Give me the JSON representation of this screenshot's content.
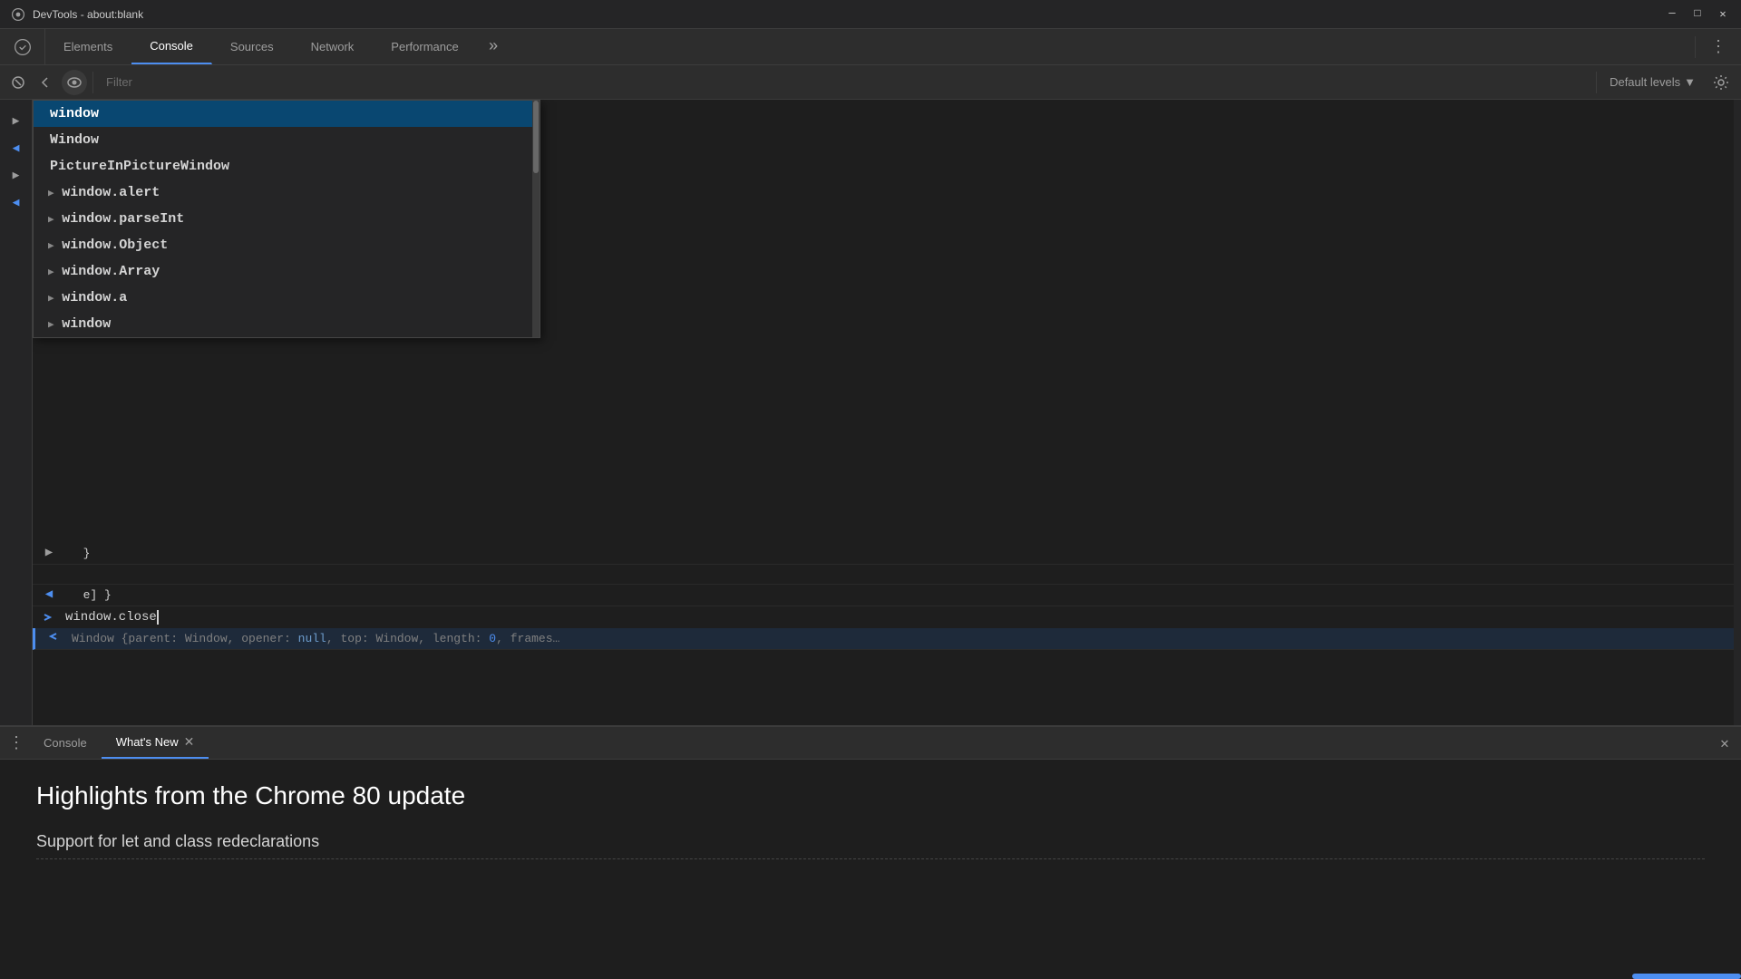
{
  "titleBar": {
    "icon": "🔧",
    "title": "DevTools - about:blank",
    "minimize": "─",
    "maximize": "□",
    "close": "✕"
  },
  "header": {
    "tabs": [
      {
        "label": "Elements",
        "active": false
      },
      {
        "label": "Console",
        "active": true
      },
      {
        "label": "Sources",
        "active": false
      },
      {
        "label": "Network",
        "active": false
      },
      {
        "label": "Performance",
        "active": false
      }
    ],
    "moreIcon": "»",
    "menuIcon": "⋮"
  },
  "toolbar": {
    "filterPlaceholder": "Filter",
    "defaultLevels": "Default levels",
    "dropdownIcon": "▼"
  },
  "autocomplete": {
    "items": [
      {
        "text": "window",
        "arrow": "",
        "selected": true
      },
      {
        "text": "Window",
        "arrow": "",
        "selected": false
      },
      {
        "text": "PictureInPictureWindow",
        "arrow": "",
        "selected": false
      },
      {
        "text": "window.alert",
        "arrow": "▶",
        "selected": false
      },
      {
        "text": "window.parseInt",
        "arrow": "▶",
        "selected": false
      },
      {
        "text": "window.Object",
        "arrow": "▶",
        "selected": false
      },
      {
        "text": "window.Array",
        "arrow": "▶",
        "selected": false
      },
      {
        "text": "window.a",
        "arrow": "▶",
        "selected": false
      },
      {
        "text": "window",
        "arrow": "▶",
        "selected": false
      }
    ]
  },
  "consoleLines": [
    {
      "type": "code",
      "gutter": "}",
      "content": ""
    },
    {
      "type": "code",
      "gutter": "",
      "content": ""
    },
    {
      "type": "code",
      "gutter": "e] }",
      "content": ""
    }
  ],
  "inputLine": {
    "prompt": "▶",
    "content": "window.close"
  },
  "outputLine": {
    "content": "Window {parent: Window, opener: null, top: Window, length: 0, frames…"
  },
  "bottomTabs": [
    {
      "label": "Console",
      "active": false
    },
    {
      "label": "What's New",
      "active": true,
      "closeable": true
    }
  ],
  "whatsNew": {
    "title": "Highlights from the Chrome 80 update",
    "section": "Support for let and class redeclarations"
  },
  "colors": {
    "accent": "#4d8ef0",
    "background": "#1e1e1e",
    "panel": "#2d2d2d",
    "border": "#3c3c3c",
    "selected": "#094771"
  }
}
